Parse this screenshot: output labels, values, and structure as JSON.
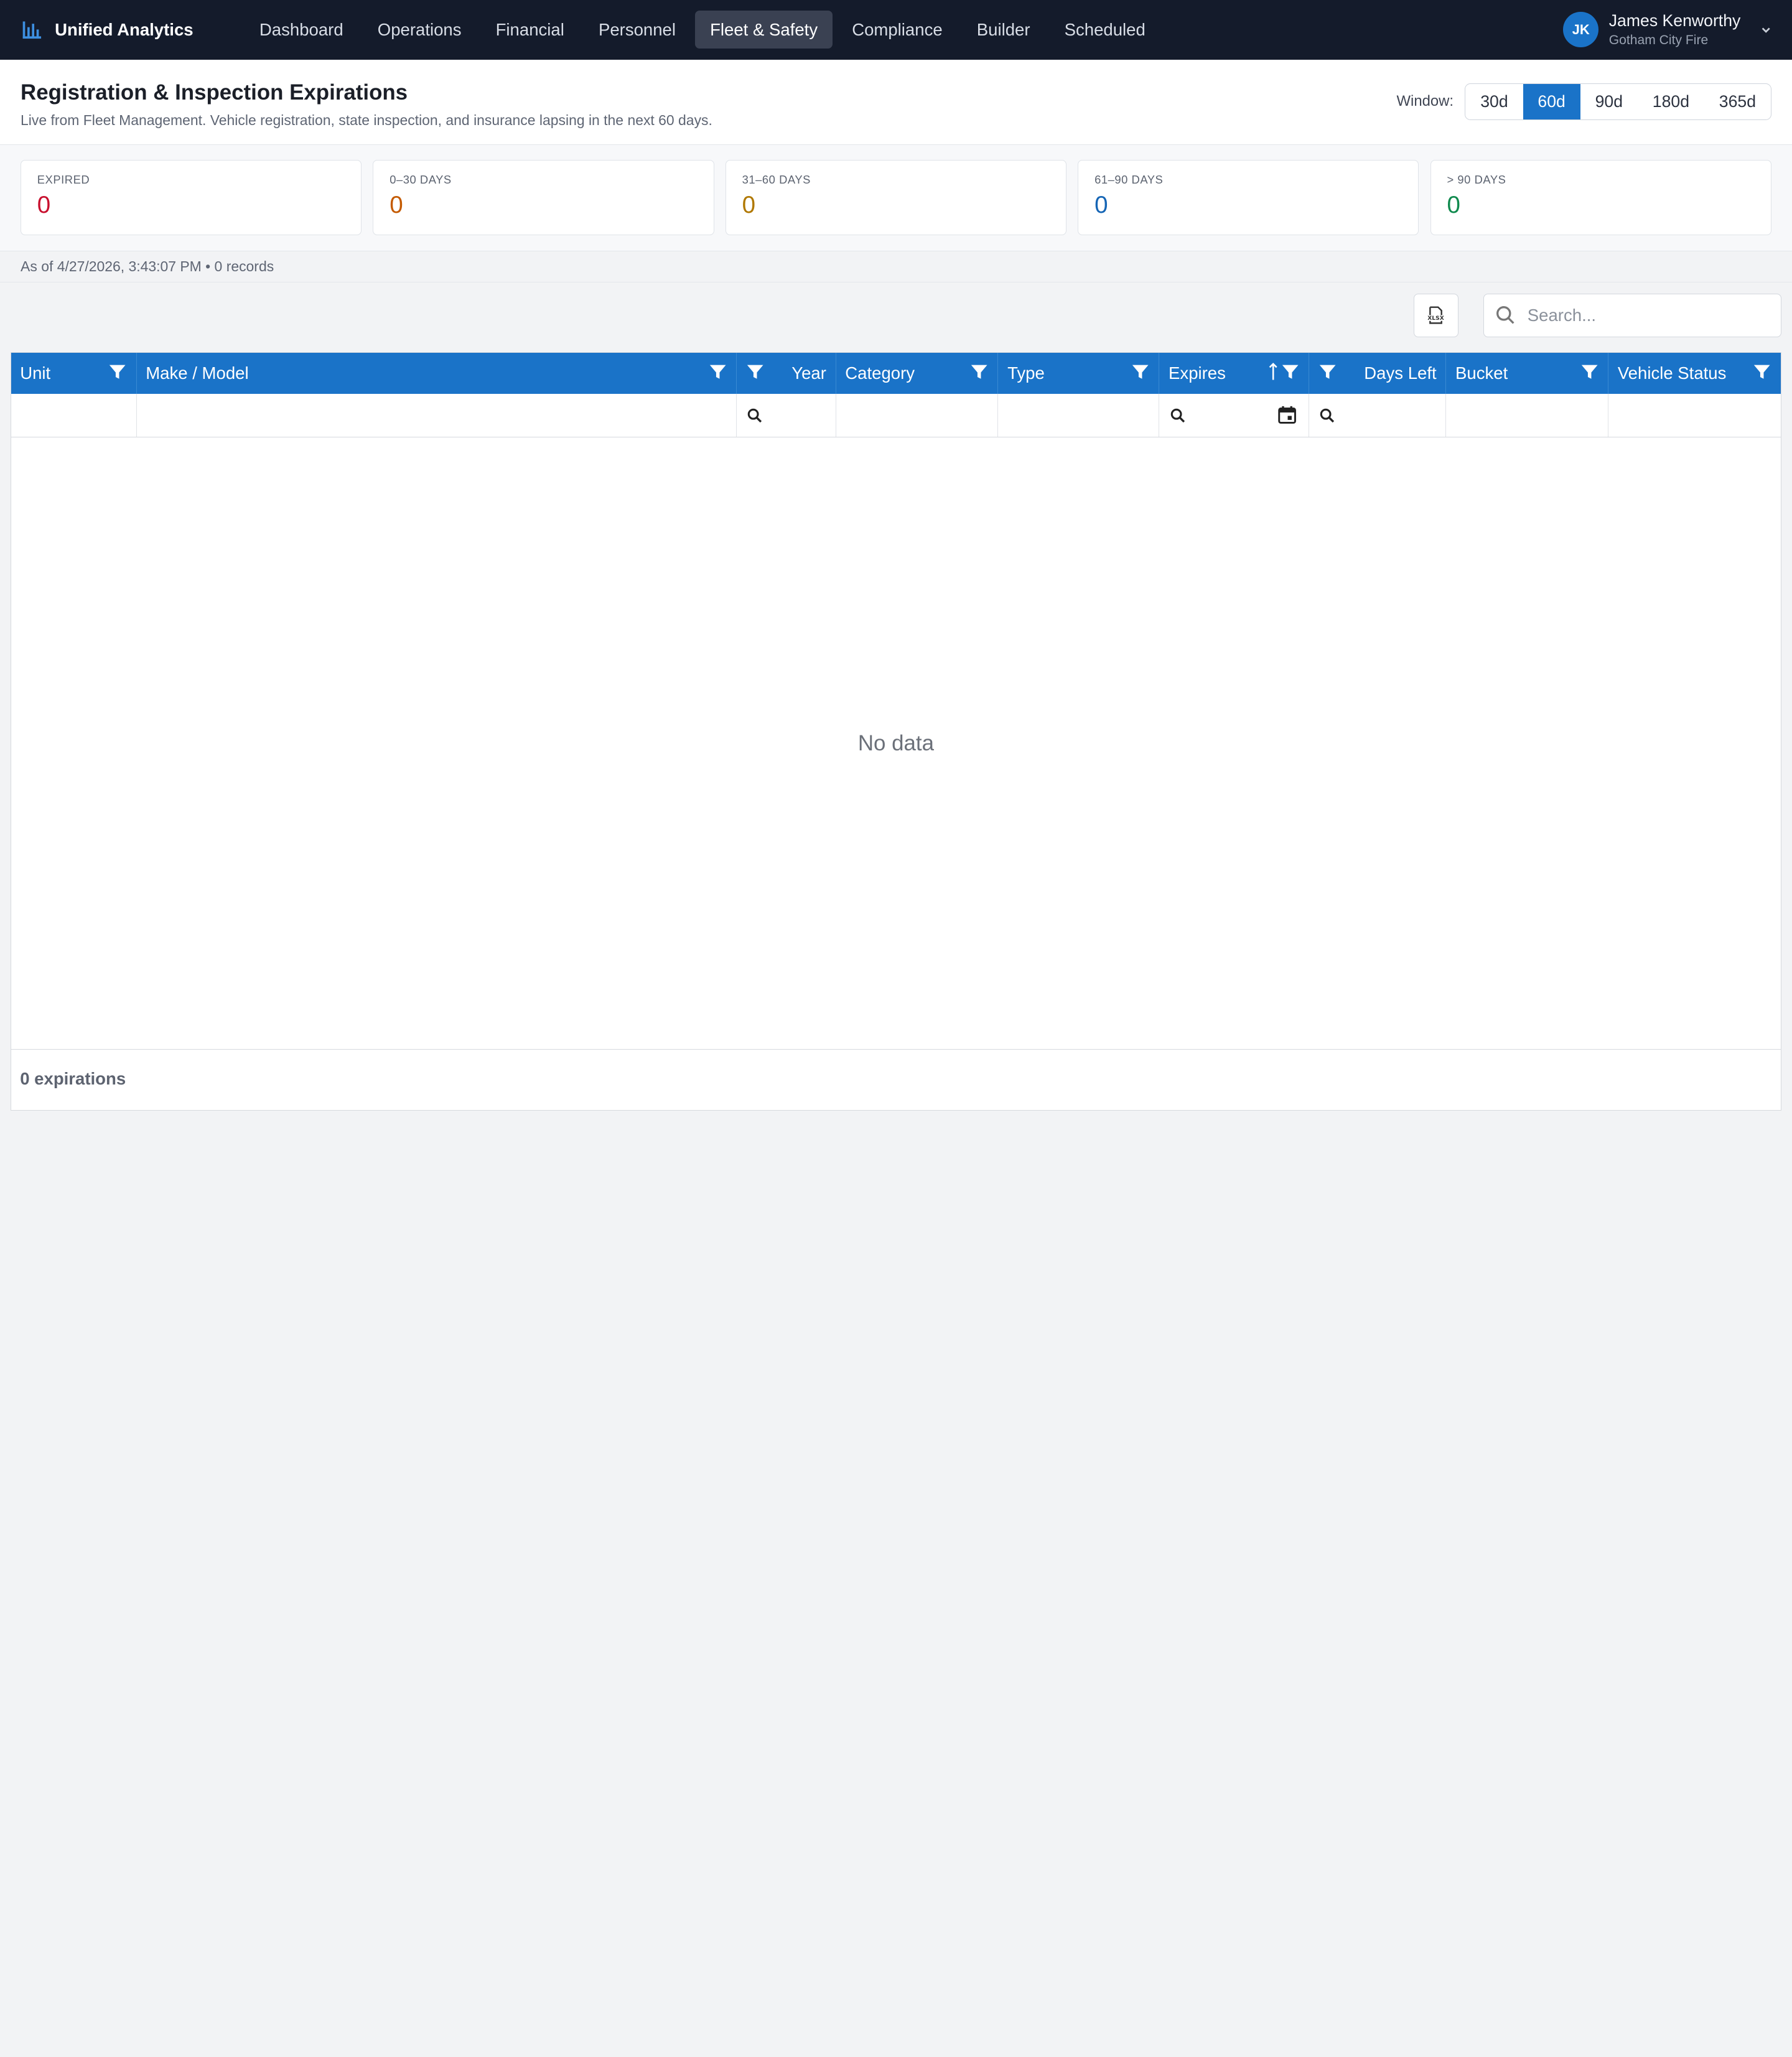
{
  "app": {
    "title": "Unified Analytics"
  },
  "nav": {
    "items": [
      {
        "label": "Dashboard"
      },
      {
        "label": "Operations"
      },
      {
        "label": "Financial"
      },
      {
        "label": "Personnel"
      },
      {
        "label": "Fleet & Safety"
      },
      {
        "label": "Compliance"
      },
      {
        "label": "Builder"
      },
      {
        "label": "Scheduled"
      }
    ],
    "active": "Fleet & Safety"
  },
  "user": {
    "initials": "JK",
    "name": "James Kenworthy",
    "org": "Gotham City Fire"
  },
  "page": {
    "title": "Registration & Inspection Expirations",
    "subtitle": "Live from Fleet Management. Vehicle registration, state inspection, and insurance lapsing in the next 60 days."
  },
  "window": {
    "label": "Window:",
    "options": [
      "30d",
      "60d",
      "90d",
      "180d",
      "365d"
    ],
    "selected": "60d"
  },
  "stats": [
    {
      "label": "EXPIRED",
      "value": "0",
      "color": "#c8102e"
    },
    {
      "label": "0–30 DAYS",
      "value": "0",
      "color": "#c45a00"
    },
    {
      "label": "31–60 DAYS",
      "value": "0",
      "color": "#b07800"
    },
    {
      "label": "61–90 DAYS",
      "value": "0",
      "color": "#1565b5"
    },
    {
      "label": "> 90 DAYS",
      "value": "0",
      "color": "#108a4e"
    }
  ],
  "asof": "As of 4/27/2026, 3:43:07 PM • 0 records",
  "toolbar": {
    "search_placeholder": "Search...",
    "export_icon": "xlsx-export-icon"
  },
  "grid": {
    "columns": [
      {
        "label": "Unit"
      },
      {
        "label": "Make / Model"
      },
      {
        "label": "Year"
      },
      {
        "label": "Category"
      },
      {
        "label": "Type"
      },
      {
        "label": "Expires"
      },
      {
        "label": "Days Left"
      },
      {
        "label": "Bucket"
      },
      {
        "label": "Vehicle Status"
      }
    ],
    "empty_text": "No data",
    "footer": "0 expirations"
  },
  "colors": {
    "accent": "#1a73c8",
    "nav_bg": "#141b2b"
  }
}
